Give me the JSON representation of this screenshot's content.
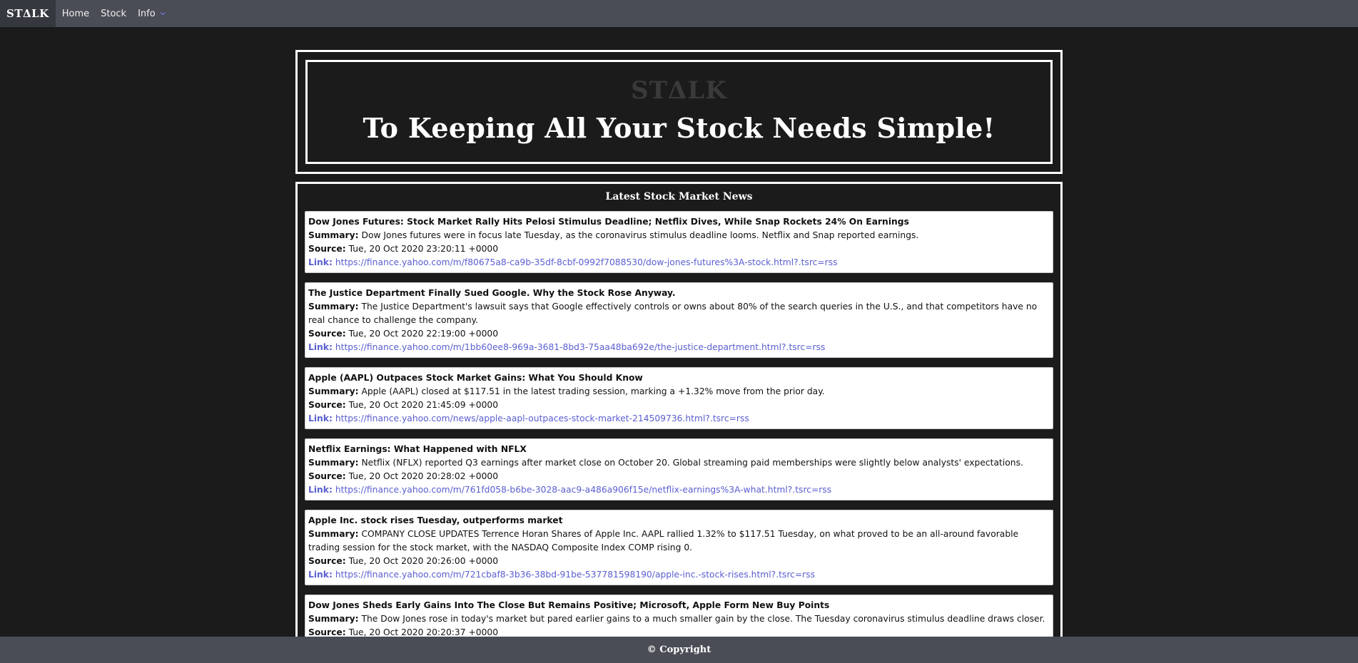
{
  "nav": {
    "brand": "STΔLK",
    "items": [
      {
        "label": "Home"
      },
      {
        "label": "Stock"
      },
      {
        "label": "Info"
      }
    ]
  },
  "hero": {
    "logo": "STΔLK",
    "tagline": "To Keeping All Your Stock Needs Simple!"
  },
  "news": {
    "heading": "Latest Stock Market News",
    "labels": {
      "summary": "Summary:",
      "source": "Source:",
      "link": "Link:"
    },
    "articles": [
      {
        "title": "Dow Jones Futures: Stock Market Rally Hits Pelosi Stimulus Deadline; Netflix Dives, While Snap Rockets 24% On Earnings",
        "summary": "Dow Jones futures were in focus late Tuesday, as the coronavirus stimulus deadline looms. Netflix and Snap reported earnings.",
        "source": "Tue, 20 Oct 2020 23:20:11 +0000",
        "link": "https://finance.yahoo.com/m/f80675a8-ca9b-35df-8cbf-0992f7088530/dow-jones-futures%3A-stock.html?.tsrc=rss"
      },
      {
        "title": "The Justice Department Finally Sued Google. Why the Stock Rose Anyway.",
        "summary": "The Justice Department's lawsuit says that Google effectively controls or owns about 80% of the search queries in the U.S., and that competitors have no real chance to challenge the company.",
        "source": "Tue, 20 Oct 2020 22:19:00 +0000",
        "link": "https://finance.yahoo.com/m/1bb60ee8-969a-3681-8bd3-75aa48ba692e/the-justice-department.html?.tsrc=rss"
      },
      {
        "title": "Apple (AAPL) Outpaces Stock Market Gains: What You Should Know",
        "summary": "Apple (AAPL) closed at $117.51 in the latest trading session, marking a +1.32% move from the prior day.",
        "source": "Tue, 20 Oct 2020 21:45:09 +0000",
        "link": "https://finance.yahoo.com/news/apple-aapl-outpaces-stock-market-214509736.html?.tsrc=rss"
      },
      {
        "title": "Netflix Earnings: What Happened with NFLX",
        "summary": "Netflix (NFLX) reported Q3 earnings after market close on October 20. Global streaming paid memberships were slightly below analysts' expectations.",
        "source": "Tue, 20 Oct 2020 20:28:02 +0000",
        "link": "https://finance.yahoo.com/m/761fd058-b6be-3028-aac9-a486a906f15e/netflix-earnings%3A-what.html?.tsrc=rss"
      },
      {
        "title": "Apple Inc. stock rises Tuesday, outperforms market",
        "summary": "COMPANY CLOSE UPDATES Terrence Horan Shares of Apple Inc. AAPL rallied 1.32% to $117.51 Tuesday, on what proved to be an all-around favorable trading session for the stock market, with the NASDAQ Composite Index COMP rising 0.",
        "source": "Tue, 20 Oct 2020 20:26:00 +0000",
        "link": "https://finance.yahoo.com/m/721cbaf8-3b36-38bd-91be-537781598190/apple-inc.-stock-rises.html?.tsrc=rss"
      },
      {
        "title": "Dow Jones Sheds Early Gains Into The Close But Remains Positive; Microsoft, Apple Form New Buy Points",
        "summary": "The Dow Jones rose in today's market but pared earlier gains to a much smaller gain by the close. The Tuesday coronavirus stimulus deadline draws closer.",
        "source": "Tue, 20 Oct 2020 20:20:37 +0000",
        "link": ""
      }
    ]
  },
  "footer": {
    "text": "© Copyright"
  },
  "colors": {
    "nav_bg": "#4a4d55",
    "page_bg": "#1b1b1b",
    "link": "#5a5fcf"
  },
  "icons": {
    "info_dropdown": "chevron-down-icon"
  }
}
